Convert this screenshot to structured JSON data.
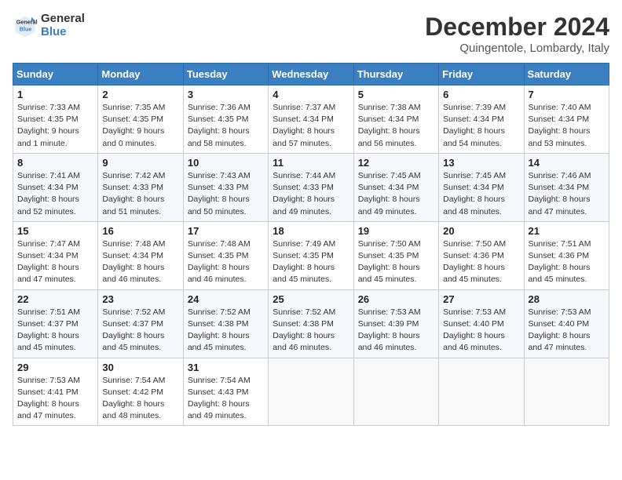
{
  "header": {
    "logo_line1": "General",
    "logo_line2": "Blue",
    "month": "December 2024",
    "location": "Quingentole, Lombardy, Italy"
  },
  "days_of_week": [
    "Sunday",
    "Monday",
    "Tuesday",
    "Wednesday",
    "Thursday",
    "Friday",
    "Saturday"
  ],
  "weeks": [
    [
      {
        "day": 1,
        "sunrise": "7:33 AM",
        "sunset": "4:35 PM",
        "daylight": "9 hours and 1 minute."
      },
      {
        "day": 2,
        "sunrise": "7:35 AM",
        "sunset": "4:35 PM",
        "daylight": "9 hours and 0 minutes."
      },
      {
        "day": 3,
        "sunrise": "7:36 AM",
        "sunset": "4:35 PM",
        "daylight": "8 hours and 58 minutes."
      },
      {
        "day": 4,
        "sunrise": "7:37 AM",
        "sunset": "4:34 PM",
        "daylight": "8 hours and 57 minutes."
      },
      {
        "day": 5,
        "sunrise": "7:38 AM",
        "sunset": "4:34 PM",
        "daylight": "8 hours and 56 minutes."
      },
      {
        "day": 6,
        "sunrise": "7:39 AM",
        "sunset": "4:34 PM",
        "daylight": "8 hours and 54 minutes."
      },
      {
        "day": 7,
        "sunrise": "7:40 AM",
        "sunset": "4:34 PM",
        "daylight": "8 hours and 53 minutes."
      }
    ],
    [
      {
        "day": 8,
        "sunrise": "7:41 AM",
        "sunset": "4:34 PM",
        "daylight": "8 hours and 52 minutes."
      },
      {
        "day": 9,
        "sunrise": "7:42 AM",
        "sunset": "4:33 PM",
        "daylight": "8 hours and 51 minutes."
      },
      {
        "day": 10,
        "sunrise": "7:43 AM",
        "sunset": "4:33 PM",
        "daylight": "8 hours and 50 minutes."
      },
      {
        "day": 11,
        "sunrise": "7:44 AM",
        "sunset": "4:33 PM",
        "daylight": "8 hours and 49 minutes."
      },
      {
        "day": 12,
        "sunrise": "7:45 AM",
        "sunset": "4:34 PM",
        "daylight": "8 hours and 49 minutes."
      },
      {
        "day": 13,
        "sunrise": "7:45 AM",
        "sunset": "4:34 PM",
        "daylight": "8 hours and 48 minutes."
      },
      {
        "day": 14,
        "sunrise": "7:46 AM",
        "sunset": "4:34 PM",
        "daylight": "8 hours and 47 minutes."
      }
    ],
    [
      {
        "day": 15,
        "sunrise": "7:47 AM",
        "sunset": "4:34 PM",
        "daylight": "8 hours and 47 minutes."
      },
      {
        "day": 16,
        "sunrise": "7:48 AM",
        "sunset": "4:34 PM",
        "daylight": "8 hours and 46 minutes."
      },
      {
        "day": 17,
        "sunrise": "7:48 AM",
        "sunset": "4:35 PM",
        "daylight": "8 hours and 46 minutes."
      },
      {
        "day": 18,
        "sunrise": "7:49 AM",
        "sunset": "4:35 PM",
        "daylight": "8 hours and 45 minutes."
      },
      {
        "day": 19,
        "sunrise": "7:50 AM",
        "sunset": "4:35 PM",
        "daylight": "8 hours and 45 minutes."
      },
      {
        "day": 20,
        "sunrise": "7:50 AM",
        "sunset": "4:36 PM",
        "daylight": "8 hours and 45 minutes."
      },
      {
        "day": 21,
        "sunrise": "7:51 AM",
        "sunset": "4:36 PM",
        "daylight": "8 hours and 45 minutes."
      }
    ],
    [
      {
        "day": 22,
        "sunrise": "7:51 AM",
        "sunset": "4:37 PM",
        "daylight": "8 hours and 45 minutes."
      },
      {
        "day": 23,
        "sunrise": "7:52 AM",
        "sunset": "4:37 PM",
        "daylight": "8 hours and 45 minutes."
      },
      {
        "day": 24,
        "sunrise": "7:52 AM",
        "sunset": "4:38 PM",
        "daylight": "8 hours and 45 minutes."
      },
      {
        "day": 25,
        "sunrise": "7:52 AM",
        "sunset": "4:38 PM",
        "daylight": "8 hours and 46 minutes."
      },
      {
        "day": 26,
        "sunrise": "7:53 AM",
        "sunset": "4:39 PM",
        "daylight": "8 hours and 46 minutes."
      },
      {
        "day": 27,
        "sunrise": "7:53 AM",
        "sunset": "4:40 PM",
        "daylight": "8 hours and 46 minutes."
      },
      {
        "day": 28,
        "sunrise": "7:53 AM",
        "sunset": "4:40 PM",
        "daylight": "8 hours and 47 minutes."
      }
    ],
    [
      {
        "day": 29,
        "sunrise": "7:53 AM",
        "sunset": "4:41 PM",
        "daylight": "8 hours and 47 minutes."
      },
      {
        "day": 30,
        "sunrise": "7:54 AM",
        "sunset": "4:42 PM",
        "daylight": "8 hours and 48 minutes."
      },
      {
        "day": 31,
        "sunrise": "7:54 AM",
        "sunset": "4:43 PM",
        "daylight": "8 hours and 49 minutes."
      },
      null,
      null,
      null,
      null
    ]
  ]
}
